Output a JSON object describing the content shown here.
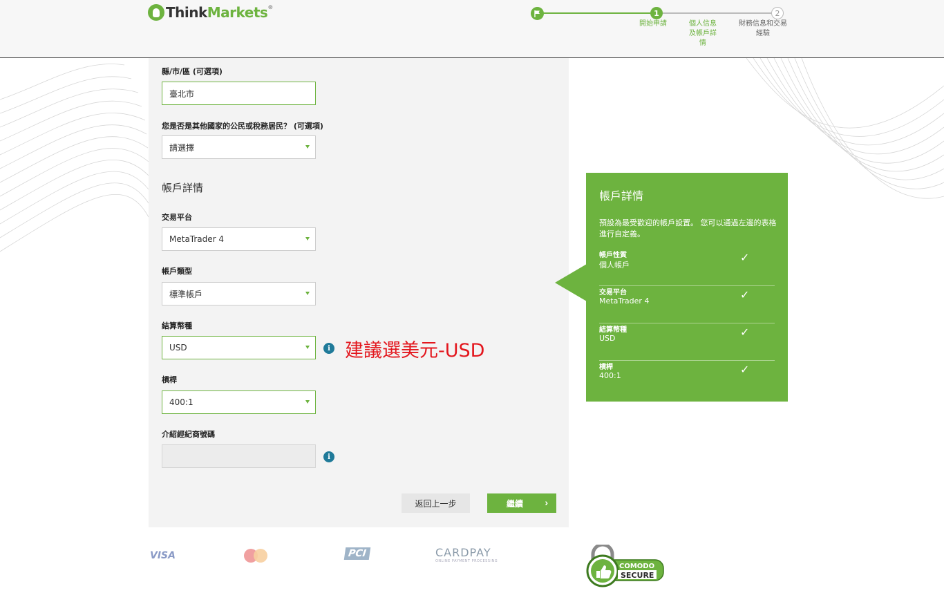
{
  "brand": {
    "name_think": "Think",
    "name_markets": "Markets",
    "reg_mark": "®"
  },
  "steps": {
    "flag_icon": "flag-icon",
    "active_number": "1",
    "active_label": "開始申請",
    "step2_label_line1": "個人信息",
    "step2_label_line2": "及帳戶詳",
    "step2_label_line3": "情",
    "pending_number": "2",
    "step3_label_line1": "財務信息和交易",
    "step3_label_line2": "經驗"
  },
  "form": {
    "county": {
      "label": "縣/市/區 (可選項)",
      "value": "臺北市"
    },
    "tax_resident": {
      "label": "您是否是其他國家的公民或稅務居民？ (可選項)",
      "value": "請選擇"
    },
    "account_section_title": "帳戶詳情",
    "platform": {
      "label": "交易平台",
      "value": "MetaTrader 4"
    },
    "account_type": {
      "label": "帳戶類型",
      "value": "標準帳戶"
    },
    "currency": {
      "label": "結算幣種",
      "value": "USD"
    },
    "leverage": {
      "label": "槓桿",
      "value": "400:1"
    },
    "introducer": {
      "label": "介紹經紀商號碼",
      "value": ""
    },
    "info_icon_glyph": "i",
    "back_label": "返回上一步",
    "next_label": "繼續",
    "next_chevron": "›"
  },
  "annotation": "建議選美元-USD",
  "summary": {
    "title": "帳戶詳情",
    "description": "預設為最受歡迎的帳戶設置。 您可以通過左邊的表格進行自定義。",
    "check_glyph": "✓",
    "rows": [
      {
        "key": "帳戶性質",
        "value": "個人帳戶"
      },
      {
        "key": "交易平台",
        "value": "MetaTrader 4"
      },
      {
        "key": "結算幣種",
        "value": "USD"
      },
      {
        "key": "槓桿",
        "value": "400:1"
      }
    ]
  },
  "footer": {
    "visa": "VISA",
    "pci": "PCI",
    "cardpay": "CARDPAY",
    "cardpay_sub": "ONLINE PAYMENT PROCESSING",
    "comodo_top": "COMODO",
    "comodo_bottom": "SECURE"
  },
  "colors": {
    "brand_green": "#6db33f",
    "info_blue": "#1f7a99",
    "annotation_red": "#e3161d"
  }
}
